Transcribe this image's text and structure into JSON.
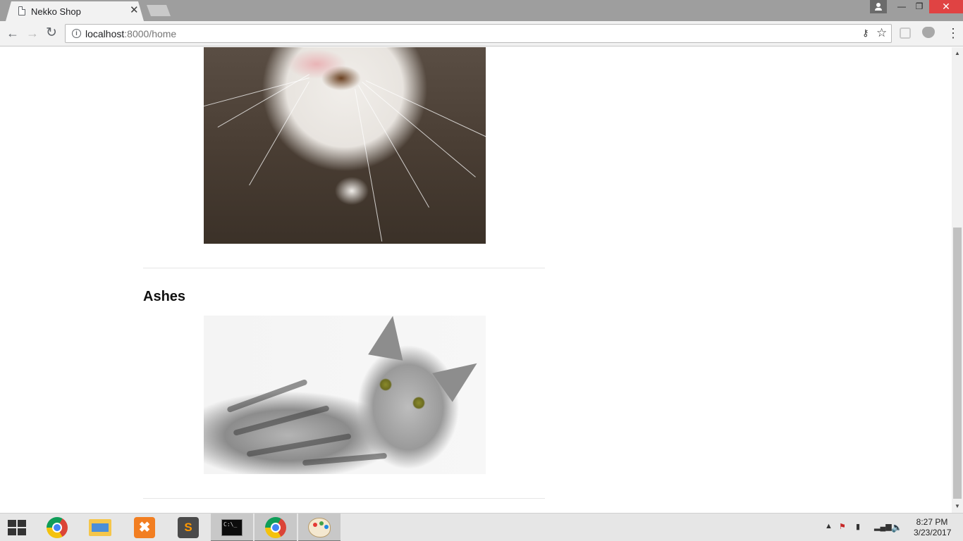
{
  "browser": {
    "tab_title": "Nekko Shop",
    "tab_close": "✕",
    "url_host": "localhost",
    "url_rest": ":8000/home",
    "window_controls": {
      "minimize": "—",
      "maximize": "❐",
      "close": "✕"
    },
    "icons": [
      "page-icon",
      "back-icon",
      "forward-icon",
      "reload-icon",
      "info-icon",
      "key-icon",
      "star-icon",
      "extension-icon",
      "menu-icon"
    ]
  },
  "page": {
    "cats": [
      {
        "name": "",
        "photo": "white-cat-photo"
      },
      {
        "name": "Ashes",
        "photo": "gray-tabby-cat-photo"
      }
    ]
  },
  "taskbar": {
    "apps": [
      "windows-start",
      "chrome",
      "file-explorer",
      "xampp",
      "sublime-text",
      "command-prompt",
      "chrome",
      "paint"
    ],
    "active_app": "chrome",
    "clock_time": "8:27 PM",
    "clock_date": "3/23/2017"
  },
  "colors": {
    "titlebar": "#9e9e9e",
    "close_button": "#e04343",
    "taskbar": "#e6e6e6"
  }
}
